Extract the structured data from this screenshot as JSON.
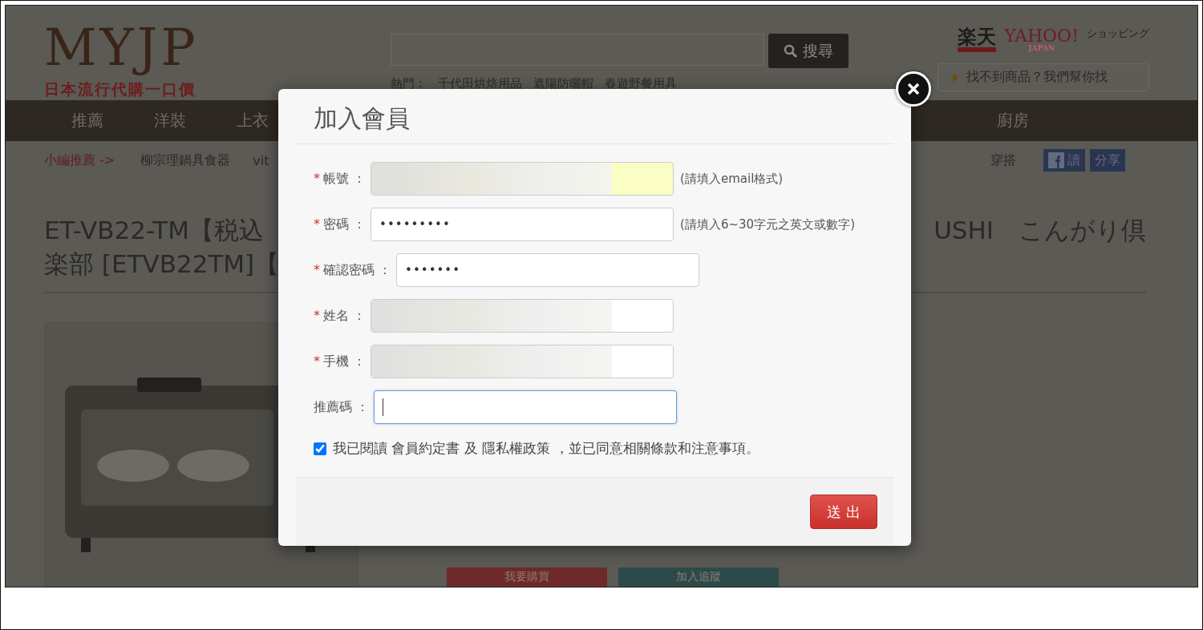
{
  "site": {
    "logo": "MYJP",
    "tagline": "日本流行代購一口價",
    "search_button": "搜尋",
    "hot_label": "熱門：",
    "hot_links": [
      "千代田烘焙用品",
      "遮陽防曬帽",
      "春遊野餐用具"
    ],
    "partner_logos": [
      "楽天",
      "YAHOO!"
    ],
    "yahoo_sub": "JAPAN",
    "shopping": "ショッピング",
    "find_button": "找不到商品？我們幫你找"
  },
  "nav": [
    "推薦",
    "洋裝",
    "上衣",
    "廚房"
  ],
  "subnav": {
    "label": "小編推薦 ->",
    "links": [
      "柳宗理鍋具食器",
      "vit",
      "穿搭"
    ],
    "share_buttons": [
      "讀",
      "分享"
    ]
  },
  "product": {
    "title_left": "ET-VB22-TM【税込",
    "title_right": "USHI　こんがり倶",
    "title_line2": "楽部 [ETVB22TM]【",
    "actions": [
      "我要購買",
      "加入追蹤"
    ]
  },
  "modal": {
    "title": "加入會員",
    "fields": [
      {
        "label": "帳號 ：",
        "mark": "*",
        "redacted": true,
        "autofill": true,
        "focused": false,
        "hint": "(請填入email格式)"
      },
      {
        "label": "密碼 ：",
        "mark": "*",
        "redacted": false,
        "autofill": false,
        "focused": false,
        "value": "•••••••••",
        "hint": "(請填入6~30字元之英文或數字)"
      },
      {
        "label": "確認密碼 ：",
        "mark": "*",
        "redacted": false,
        "autofill": false,
        "focused": false,
        "value": "•••••••"
      },
      {
        "label": "姓名 ：",
        "mark": "*",
        "redacted": true,
        "autofill": false,
        "focused": false
      },
      {
        "label": "手機 ：",
        "mark": "*",
        "redacted": true,
        "autofill": false,
        "focused": false
      },
      {
        "label": "推薦碼 ：",
        "redacted": false,
        "autofill": false,
        "focused": true
      }
    ],
    "agree": {
      "checked": true,
      "text": "我已閱讀 會員約定書 及 隱私權政策 ，並已同意相關條款和注意事項。"
    },
    "submit": "送 出"
  }
}
